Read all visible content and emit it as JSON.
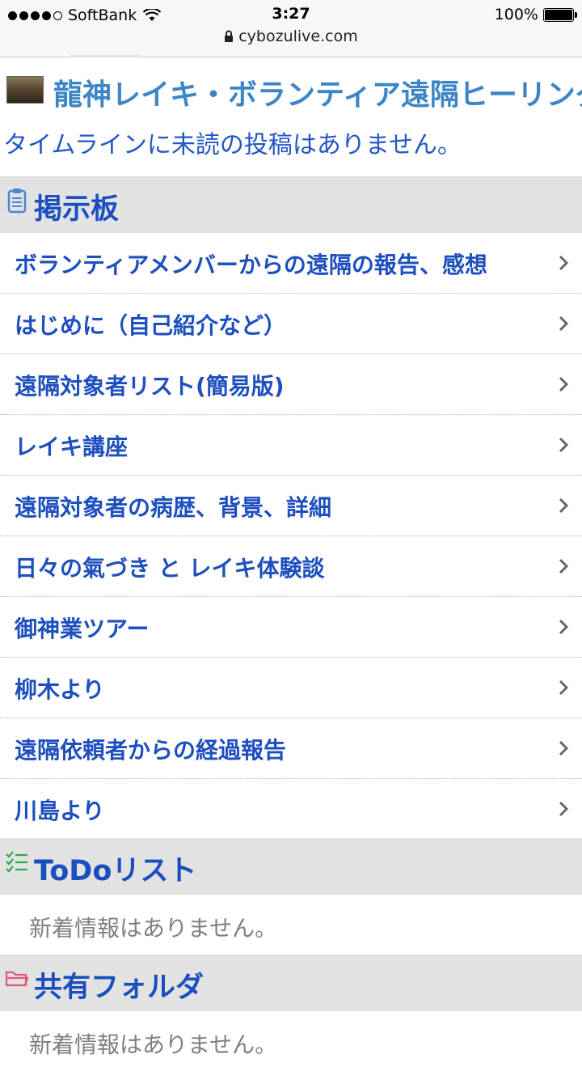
{
  "status_bar": {
    "carrier": "SoftBank",
    "time": "3:27",
    "battery_percent": "100%",
    "url": "cybozulive.com"
  },
  "group": {
    "title": "龍神レイキ・ボランティア遠隔ヒーリング",
    "timeline_message": "タイムラインに未読の投稿はありません。"
  },
  "bulletin_board": {
    "title": "掲示板",
    "items": [
      {
        "label": "ボランティアメンバーからの遠隔の報告、感想"
      },
      {
        "label": "はじめに（自己紹介など）"
      },
      {
        "label": "遠隔対象者リスト(簡易版)"
      },
      {
        "label": "レイキ講座"
      },
      {
        "label": "遠隔対象者の病歴、背景、詳細"
      },
      {
        "label": "日々の氣づき と レイキ体験談"
      },
      {
        "label": "御神業ツアー"
      },
      {
        "label": "柳木より"
      },
      {
        "label": "遠隔依頼者からの経過報告"
      },
      {
        "label": "川島より"
      }
    ]
  },
  "todo": {
    "title": "ToDoリスト",
    "empty_message": "新着情報はありません。"
  },
  "shared_folder": {
    "title": "共有フォルダ",
    "empty_message": "新着情報はありません。"
  },
  "icons": {
    "bulletin": "clipboard-icon",
    "todo": "checklist-icon",
    "folder": "folder-icon",
    "chevron": "chevron-right-icon"
  },
  "colors": {
    "link_blue": "#1e4fbf",
    "group_title_blue": "#3d86c6",
    "section_bg": "#e2e2e2",
    "clipboard_blue": "#4a86d4",
    "todo_green": "#2aa84a",
    "folder_pink": "#e05b7a"
  }
}
